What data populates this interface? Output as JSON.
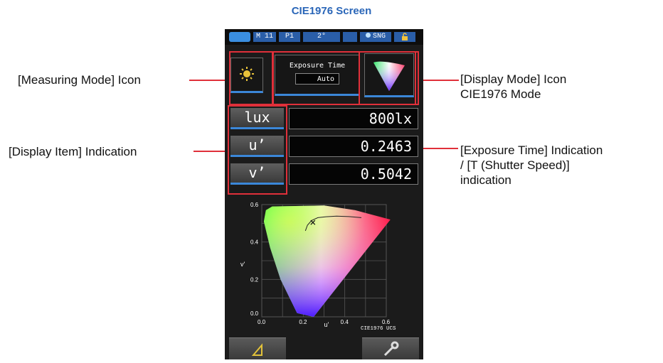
{
  "page_title": "CIE1976 Screen",
  "annotations": {
    "measuring_mode": "[Measuring Mode] Icon",
    "display_item": "[Display Item] Indication",
    "display_mode_1": "[Display Mode] Icon",
    "display_mode_2": "CIE1976 Mode",
    "exposure_1": "[Exposure Time] Indication",
    "exposure_2": "/ [T (Shutter Speed)]",
    "exposure_3": "indication"
  },
  "status_bar": {
    "m_value": "M 11",
    "p_value": "P1",
    "angle": "2°",
    "mode": "SNG"
  },
  "exposure": {
    "label": "Exposure Time",
    "value": "Auto"
  },
  "rows": [
    {
      "label": "lux",
      "value": "800lx"
    },
    {
      "label": "u’",
      "value": "0.2463"
    },
    {
      "label": "v’",
      "value": "0.5042"
    }
  ],
  "chart_data": {
    "type": "scatter",
    "title": "",
    "xlabel": "u'",
    "ylabel": "v'",
    "xlim": [
      0,
      0.6
    ],
    "ylim": [
      0,
      0.6
    ],
    "x_ticks": [
      "0.0",
      "0.2",
      "0.4",
      "0.6"
    ],
    "y_ticks": [
      "0.0",
      "0.2",
      "0.4",
      "0.6"
    ],
    "corner_label": "CIE1976 UCS",
    "grid": true,
    "measured_point": {
      "u": 0.2463,
      "v": 0.5042
    }
  },
  "icons": {
    "measuring_mode": "sun-icon",
    "display_mode": "color-triangle-icon",
    "bottom_left": "triangle-ruler-icon",
    "bottom_right": "wrench-icon"
  }
}
